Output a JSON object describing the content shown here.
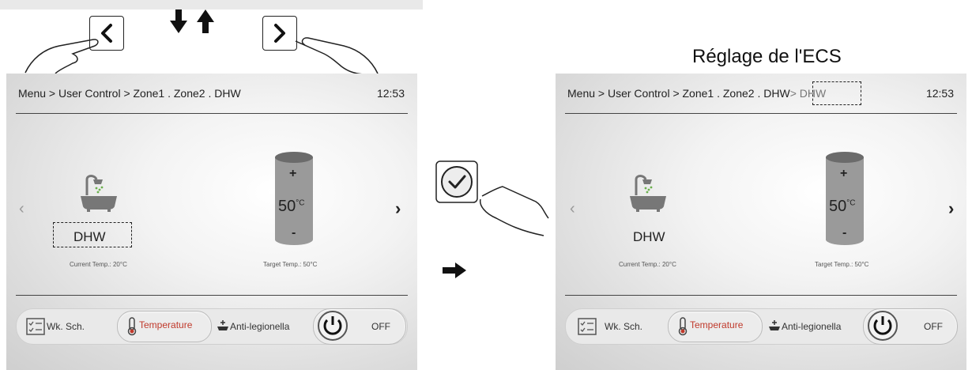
{
  "caption_right": "Réglage de l'ECS",
  "left_screen": {
    "breadcrumb": "Menu > User Control > Zone1 . Zone2 . DHW",
    "time": "12:53",
    "prev": "‹",
    "next": "›",
    "dhw_label": "DHW",
    "current_temp": "Current Temp.: 20°C",
    "target_temp": "Target Temp.: 50°C",
    "tank_value": "50",
    "tank_unit": "°C",
    "plus": "+",
    "minus": "-",
    "tabs": {
      "wk_sch": "Wk. Sch.",
      "temperature": "Temperature",
      "anti_legionella": "Anti-legionella",
      "off": "OFF"
    }
  },
  "right_screen": {
    "breadcrumb": "Menu > User Control > Zone1 . Zone2 . DHW",
    "breadcrumb_extra": "> DHW",
    "time": "12:53",
    "prev": "‹",
    "next": "›",
    "dhw_label": "DHW",
    "current_temp": "Current Temp.: 20°C",
    "target_temp": "Target Temp.: 50°C",
    "tank_value": "50",
    "tank_unit": "°C",
    "plus": "+",
    "minus": "-",
    "tabs": {
      "wk_sch": "Wk. Sch.",
      "temperature": "Temperature",
      "anti_legionella": "Anti-legionella",
      "off": "OFF"
    }
  },
  "colors": {
    "tank_body": "#9a9a9a",
    "tank_top": "#6b6b6b",
    "thermometer_red": "#c0392b"
  }
}
